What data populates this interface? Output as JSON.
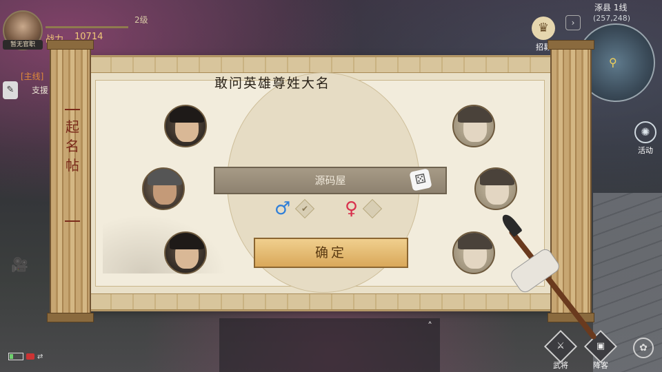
{
  "hud": {
    "rank_title": "暂无官职",
    "level": "2级",
    "power_label": "战力",
    "power_value": "10714",
    "quest_tag": "[主线]",
    "quest_text": "支援",
    "recruit_label": "招募",
    "server": "涿县 1线",
    "coords": "(257,248)",
    "activity_label": "活动",
    "generals_label": "武将",
    "surrender_label": "降客"
  },
  "dialog": {
    "scroll_title": "起名帖",
    "heading": "敢问英雄尊姓大名",
    "name_value": "源码屋",
    "male_symbol": "♂",
    "female_symbol": "♀",
    "confirm_label": "确定",
    "selected_gender": "male"
  },
  "icons": {
    "dice": "dice-icon",
    "check": "check-icon",
    "camera": "camera-icon",
    "minimap_pin": "location-pin-icon"
  },
  "colors": {
    "male": "#2f7fd8",
    "female": "#d8324e",
    "accent_gold": "#f0c878",
    "quest_orange": "#e08a3a"
  }
}
